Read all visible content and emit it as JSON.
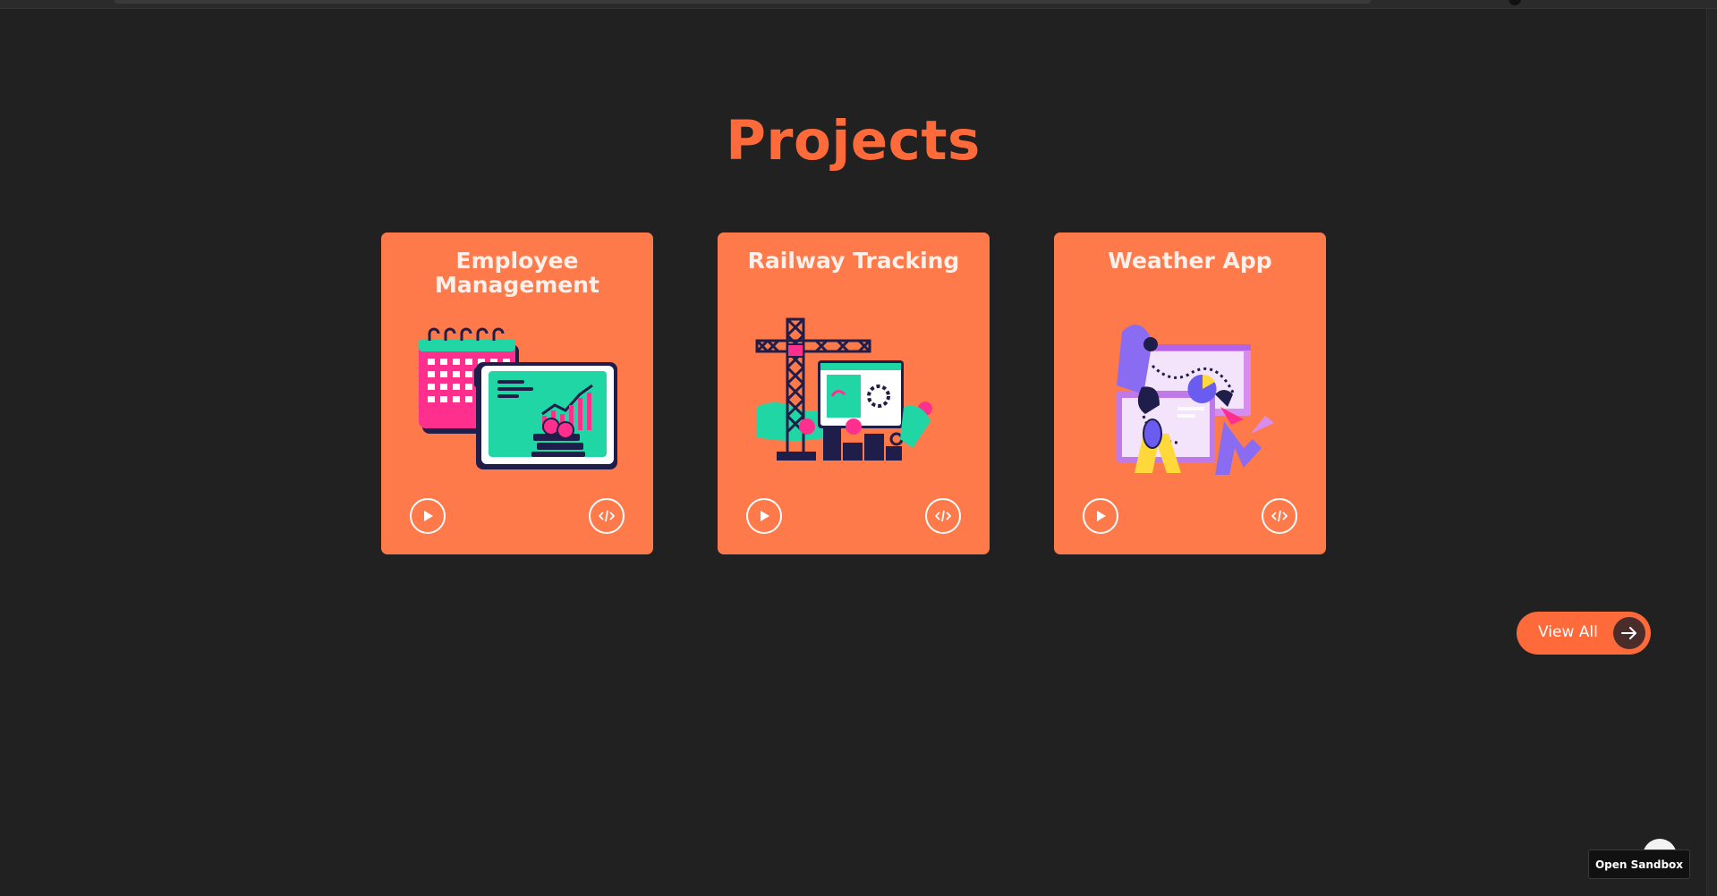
{
  "section": {
    "title": "Projects"
  },
  "projects": [
    {
      "title": "Employee Management",
      "illustration": "calendar-chart-illustration",
      "demo_icon": "play-icon",
      "code_icon": "code-icon"
    },
    {
      "title": "Railway Tracking",
      "illustration": "crane-dashboard-illustration",
      "demo_icon": "play-icon",
      "code_icon": "code-icon"
    },
    {
      "title": "Weather App",
      "illustration": "people-dashboard-illustration",
      "demo_icon": "play-icon",
      "code_icon": "code-icon"
    }
  ],
  "view_all": {
    "label": "View All",
    "icon": "arrow-right-icon"
  },
  "sandbox": {
    "label": "Open Sandbox"
  },
  "colors": {
    "background": "#212121",
    "accent": "#ff6a3a",
    "card": "#ff7a4b",
    "card_text": "#fdf0ea"
  }
}
